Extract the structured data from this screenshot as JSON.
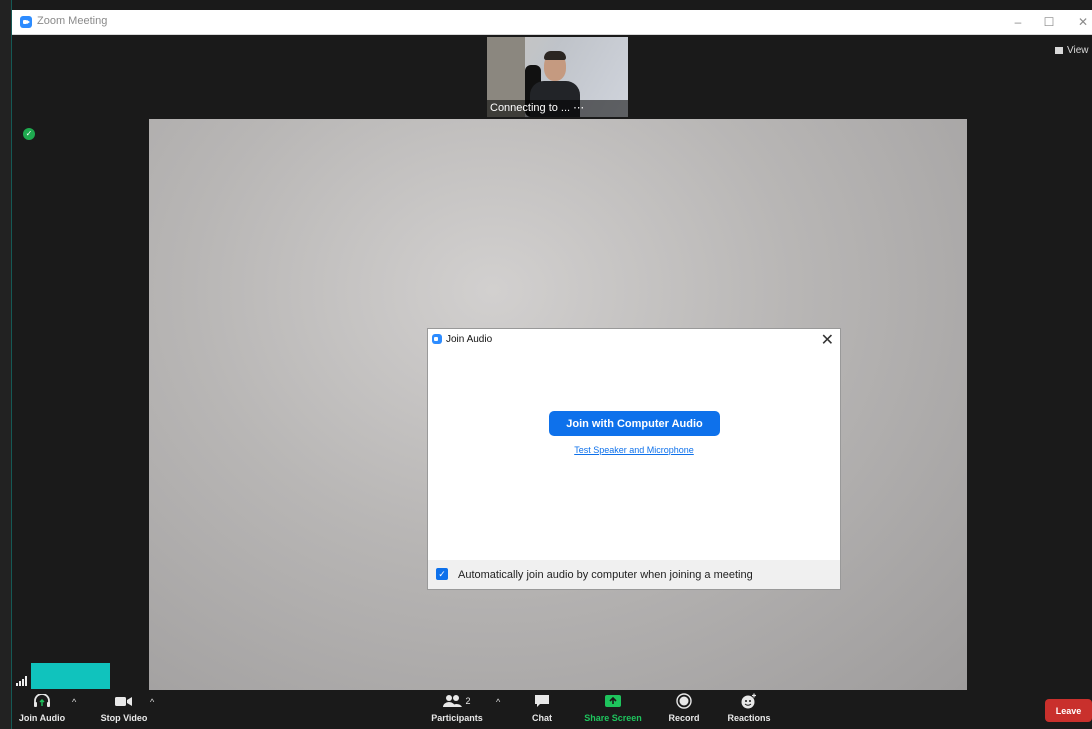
{
  "window": {
    "title": "Zoom Meeting",
    "minimize": "–",
    "maximize": "☐",
    "close": "✕"
  },
  "view": {
    "label": "View"
  },
  "thumbnail": {
    "caption": "Connecting to ... ⋯"
  },
  "dialog": {
    "title": "Join Audio",
    "close": "✕",
    "join_button": "Join with Computer Audio",
    "test_link": "Test Speaker and Microphone",
    "auto_join_label": "Automatically join audio by computer when joining a meeting",
    "auto_join_checked": true
  },
  "toolbar": {
    "join_audio": "Join Audio",
    "stop_video": "Stop Video",
    "participants": "Participants",
    "participants_count": "2",
    "chat": "Chat",
    "share_screen": "Share Screen",
    "record": "Record",
    "reactions": "Reactions",
    "leave": "Leave"
  },
  "colors": {
    "accent": "#0e71eb",
    "share": "#1ec45d",
    "leave": "#c9302c",
    "teal": "#10c3bd"
  }
}
